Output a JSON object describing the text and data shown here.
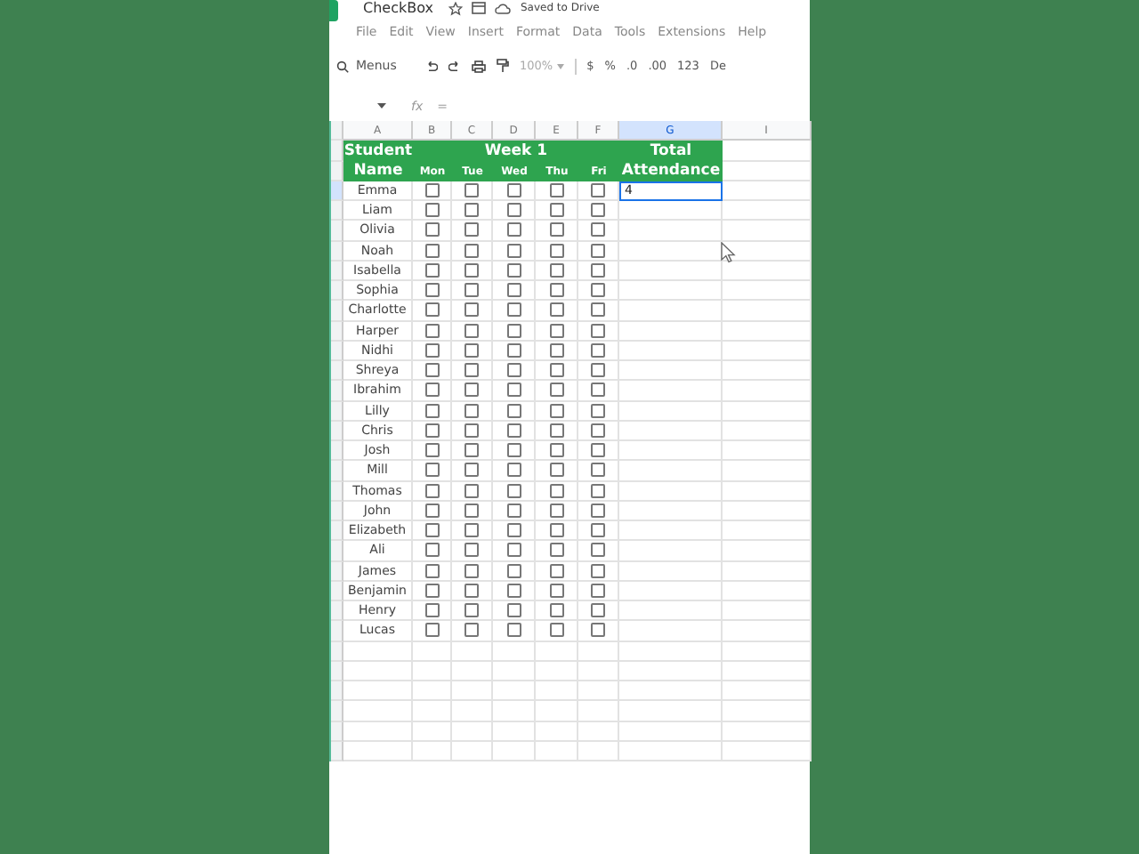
{
  "title": "CheckBox",
  "save_status": "Saved to Drive",
  "menu": [
    "File",
    "Edit",
    "View",
    "Insert",
    "Format",
    "Data",
    "Tools",
    "Extensions",
    "Help"
  ],
  "toolbar": {
    "search": "Menus",
    "zoom": "100%",
    "buttons": [
      "$",
      "%",
      ".0",
      ".00",
      "123",
      "De"
    ]
  },
  "formula_bar": {
    "fx": "fx",
    "formula": "="
  },
  "columns": [
    {
      "label": "A",
      "selected": false
    },
    {
      "label": "B",
      "selected": false
    },
    {
      "label": "C",
      "selected": false
    },
    {
      "label": "D",
      "selected": false
    },
    {
      "label": "E",
      "selected": false
    },
    {
      "label": "F",
      "selected": false
    },
    {
      "label": "G",
      "selected": true
    },
    {
      "label": "I",
      "selected": false
    }
  ],
  "header": {
    "name_top": "Student",
    "name_bottom": "Name",
    "week": "Week 1",
    "days": [
      "Mon",
      "Tue",
      "Wed",
      "Thu",
      "Fri"
    ],
    "total_top": "Total",
    "total_bottom": "Attendance"
  },
  "students": [
    {
      "name": "Emma",
      "checks": [
        false,
        false,
        false,
        false,
        false
      ],
      "total": "4",
      "selected": true
    },
    {
      "name": "Liam",
      "checks": [
        false,
        false,
        false,
        false,
        false
      ],
      "selected": false
    },
    {
      "name": "Olivia",
      "checks": [
        false,
        false,
        false,
        false,
        false
      ],
      "selected": false
    },
    {
      "name": "Noah",
      "checks": [
        false,
        false,
        false,
        false,
        false
      ],
      "selected": false
    },
    {
      "name": "Isabella",
      "checks": [
        false,
        false,
        false,
        false,
        false
      ],
      "selected": false
    },
    {
      "name": "Sophia",
      "checks": [
        false,
        false,
        false,
        false,
        false
      ],
      "selected": false
    },
    {
      "name": "Charlotte",
      "checks": [
        false,
        false,
        false,
        false,
        false
      ],
      "selected": false
    },
    {
      "name": "Harper",
      "checks": [
        false,
        false,
        false,
        false,
        false
      ],
      "selected": false
    },
    {
      "name": "Nidhi",
      "checks": [
        false,
        false,
        false,
        false,
        false
      ],
      "selected": false
    },
    {
      "name": "Shreya",
      "checks": [
        false,
        false,
        false,
        false,
        false
      ],
      "selected": false
    },
    {
      "name": "Ibrahim",
      "checks": [
        false,
        false,
        false,
        false,
        false
      ],
      "selected": false
    },
    {
      "name": "Lilly",
      "checks": [
        false,
        false,
        false,
        false,
        false
      ],
      "selected": false
    },
    {
      "name": "Chris",
      "checks": [
        false,
        false,
        false,
        false,
        false
      ],
      "selected": false
    },
    {
      "name": "Josh",
      "checks": [
        false,
        false,
        false,
        false,
        false
      ],
      "selected": false
    },
    {
      "name": "Mill",
      "checks": [
        false,
        false,
        false,
        false,
        false
      ],
      "selected": false
    },
    {
      "name": "Thomas",
      "checks": [
        false,
        false,
        false,
        false,
        false
      ],
      "selected": false
    },
    {
      "name": "John",
      "checks": [
        false,
        false,
        false,
        false,
        false
      ],
      "selected": false
    },
    {
      "name": "Elizabeth",
      "checks": [
        false,
        false,
        false,
        false,
        false
      ],
      "selected": false
    },
    {
      "name": "Ali",
      "checks": [
        false,
        false,
        false,
        false,
        false
      ],
      "selected": false
    },
    {
      "name": "James",
      "checks": [
        false,
        false,
        false,
        false,
        false
      ],
      "selected": false
    },
    {
      "name": "Benjamin",
      "checks": [
        false,
        false,
        false,
        false,
        false
      ],
      "selected": false
    },
    {
      "name": "Henry",
      "checks": [
        false,
        false,
        false,
        false,
        false
      ],
      "selected": false
    },
    {
      "name": "Lucas",
      "checks": [
        false,
        false,
        false,
        false,
        false
      ],
      "selected": false
    }
  ]
}
